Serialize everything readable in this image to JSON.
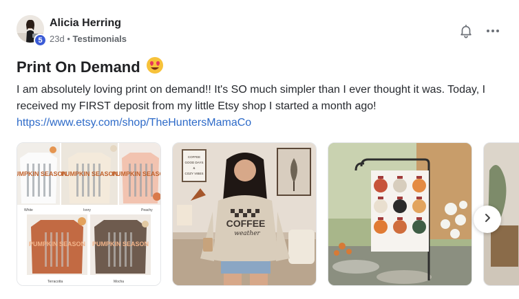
{
  "author": {
    "name": "Alicia Herring",
    "level": "5",
    "age": "23d",
    "separator": "•",
    "category": "Testimonials"
  },
  "post": {
    "title": "Print On Demand",
    "emoji": "heart-eyes-emoji",
    "body": "I am absolutely loving print on demand!! It's SO much simpler than I ever thought it was. Today, I received my FIRST deposit from my little Etsy shop I started a month ago!",
    "link": "https://www.etsy.com/shop/TheHuntersMamaCo"
  },
  "gallery": {
    "image1": {
      "shirt_text": "PUMPKIN SEASON",
      "colors": [
        "White",
        "Ivory",
        "Peachy",
        "Terracotta",
        "Mocha"
      ]
    },
    "image2": {
      "shirt_line1": "COFFEE",
      "shirt_line2": "weather",
      "poster_lines": [
        "COFFEE",
        "GOOD DAYS",
        "&",
        "COZY VIBES"
      ]
    },
    "image3": {
      "description_icon": "pumpkin-garden-flag"
    }
  },
  "icons": {
    "bell": "bell-icon",
    "more": "more-horizontal-icon",
    "next": "chevron-right-icon"
  },
  "colors": {
    "accent_link": "#2d6ac8",
    "level_badge": "#3b5bd6"
  }
}
